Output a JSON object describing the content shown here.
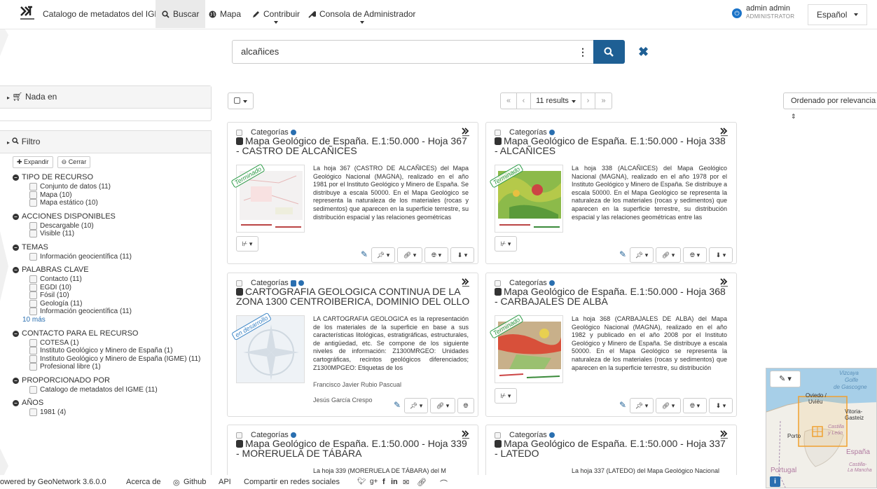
{
  "navbar": {
    "brand": "Catalogo de metadatos del IGME",
    "search": "Buscar",
    "map": "Mapa",
    "contribute": "Contribuir",
    "admin_console": "Consola de Administrador",
    "user_name": "admin admin",
    "user_role": "ADMINISTRATOR",
    "language": "Español"
  },
  "search": {
    "value": "alcañices"
  },
  "left": {
    "nada_en": "Nada en",
    "filtro": "Filtro",
    "expandir": "Expandir",
    "cerrar": "Cerrar",
    "groups": [
      {
        "title": "TIPO DE RECURSO",
        "items": [
          "Conjunto de datos (11)",
          "Mapa (10)",
          "Mapa estático (10)"
        ]
      },
      {
        "title": "ACCIONES DISPONIBLES",
        "items": [
          "Descargable (10)",
          "Visible (11)"
        ]
      },
      {
        "title": "TEMAS",
        "items": [
          "Información geocientífica (11)"
        ]
      },
      {
        "title": "PALABRAS CLAVE",
        "items": [
          "Contacto (11)",
          "EGDI (10)",
          "Fósil (10)",
          "Geología (11)",
          "Información geocientífica (11)"
        ],
        "more": "10 más"
      },
      {
        "title": "CONTACTO PARA EL RECURSO",
        "items": [
          "COTESA (1)",
          "Instituto Geológico y Minero de España (1)",
          "Instituto Geológico y Minero de España (IGME) (11)",
          "Profesional libre (1)"
        ]
      },
      {
        "title": "PROPORCIONADO POR",
        "items": [
          "Catalogo de metadatos del IGME (11)"
        ]
      },
      {
        "title": "AÑOS",
        "items": [
          "1981 (4)"
        ]
      }
    ]
  },
  "toolbar": {
    "results": "11 results",
    "first": "«",
    "prev": "‹",
    "next": "›",
    "last": "»",
    "sort": "Ordenado por relevancia"
  },
  "cards": [
    {
      "category": "Categorías",
      "title": "Mapa Geológico de España. E.1:50.000 - Hoja 367 - CASTRO DE ALCAÑICES",
      "status": "Terminado",
      "abstract": "La hoja 367 (CASTRO DE ALCAÑICES) del Mapa Geológico Nacional (MAGNA), realizado en el año 1981 por el Instituto Geológico y Minero de España. Se distribuye a escala 50000. En el Mapa Geológico se representa la naturaleza de los materiales (rocas y sedimentos) que aparecen en la superficie terrestre, su distribución espacial y las relaciones geométricas"
    },
    {
      "category": "Categorías",
      "title": "Mapa Geológico de España. E.1:50.000 - Hoja 338 - ALCAÑICES",
      "status": "Terminado",
      "abstract": "La hoja 338 (ALCAÑICES) del Mapa Geológico Nacional (MAGNA), realizado en el año 1978 por el Instituto Geológico y Minero de España. Se distribuye a escala 50000. En el Mapa Geológico se representa la naturaleza de los materiales (rocas y sedimentos) que aparecen en la superficie terrestre, su distribución espacial y las relaciones geométricas entre las"
    },
    {
      "category": "Categorías",
      "title": "CARTOGRAFIA GEOLOGICA CONTINUA DE LA ZONA 1300 CENTROIBERICA, DOMINIO DEL OLLO",
      "status": "en desarrollo",
      "abstract": "LA CARTOGRAFIA GEOLOGICA es la representación de los materiales de la superficie en base a sus características litológicas, estratigráficas, estructurales, de antigüedad, etc. Se compone de los siguiente niveles de información: Z1300MRGEO: Unidades cartográficas, recintos geológicos diferenciados; Z1300MPGEO: Etiquetas de los",
      "author1": "Francisco Javier Rubio Pascual",
      "author2": "Jesús García Crespo"
    },
    {
      "category": "Categorías",
      "title": "Mapa Geológico de España. E.1:50.000 - Hoja 368 - CARBAJALES DE ALBA",
      "status": "Terminado",
      "abstract": "La hoja 368 (CARBAJALES DE ALBA) del Mapa Geológico Nacional (MAGNA), realizado en el año 1982 y publicado en el año 2008 por el Instituto Geológico y Minero de España. Se distribuye a escala 50000. En el Mapa Geológico se representa la naturaleza de los materiales (rocas y sedimentos) que aparecen en la superficie terrestre, su distribución"
    },
    {
      "category": "Categorías",
      "title": "Mapa Geológico de España. E.1:50.000 - Hoja 339 - MORERUELA DE TÁBARA",
      "abstract": "La hoja 339 (MORERUELA DE TÁBARA) del M"
    },
    {
      "category": "Categorías",
      "title": "Mapa Geológico de España. E.1:50.000 - Hoja 337 - LATEDO",
      "abstract": "La hoja 337 (LATEDO) del Mapa Geológico Nacional"
    }
  ],
  "map": {
    "labels": [
      "Vizcaya",
      "Golfe",
      "de Gascogne",
      "Oviedo /",
      "Uviéu",
      "Vitoria-Gasteiz",
      "Castilla",
      "y León",
      "Porto",
      "España",
      "Portugal",
      "Castilla-",
      "La Mancha"
    ]
  },
  "footer": {
    "powered": "owered by GeoNetwork 3.6.0.0",
    "about": "Acerca de",
    "github": "Github",
    "api": "API",
    "share": "Compartir en redes sociales"
  }
}
